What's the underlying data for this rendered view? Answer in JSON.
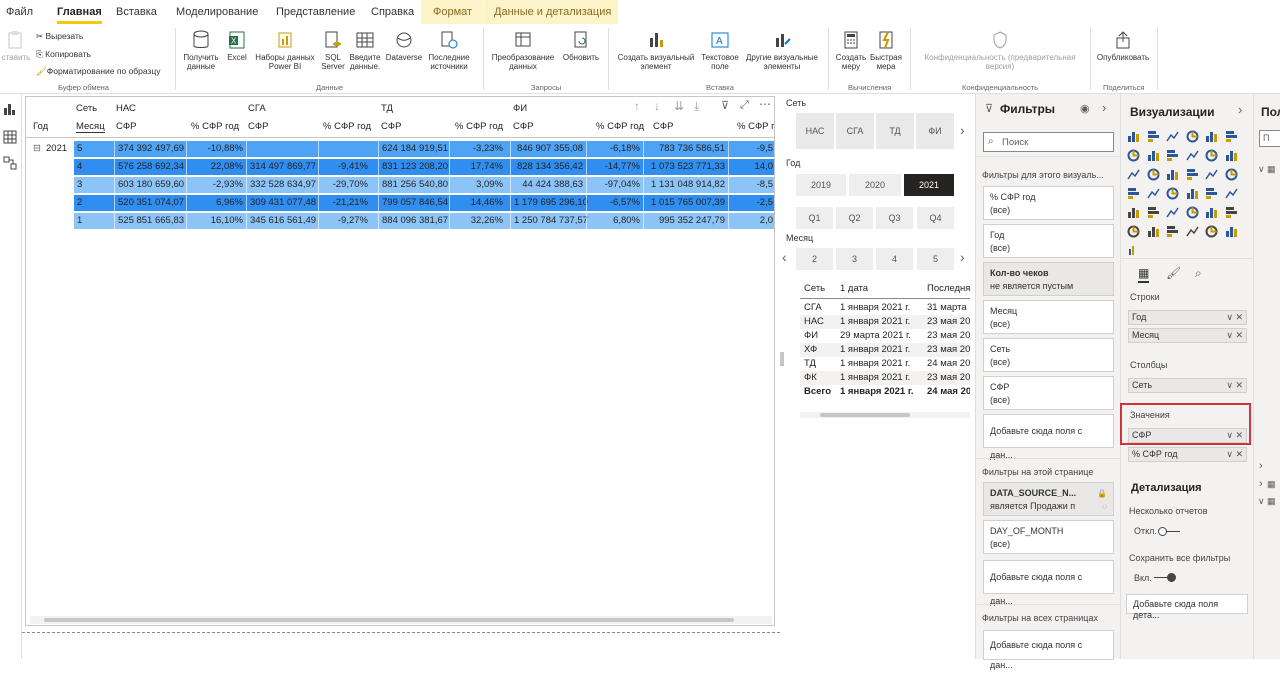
{
  "menu": {
    "items": [
      "Файл",
      "Главная",
      "Вставка",
      "Моделирование",
      "Представление",
      "Справка"
    ],
    "active": "Главная",
    "context_tabs": [
      "Формат",
      "Данные и детализация"
    ]
  },
  "ribbon": {
    "paste": "ставить",
    "cut": "Вырезать",
    "copy": "Копировать",
    "format_painter": "Форматирование по образцу",
    "clipboard_group": "Буфер обмена",
    "get_data": "Получить данные",
    "excel": "Excel",
    "datasets": "Наборы данных Power BI",
    "sql": "SQL Server",
    "enter_data": "Введите данные.",
    "dataverse": "Dataverse",
    "recent_sources": "Последние источники",
    "data_group": "Данные",
    "transform": "Преобразование данных",
    "refresh": "Обновить",
    "queries_group": "Запросы",
    "new_visual": "Создать визуальный элемент",
    "text_box": "Текстовое поле",
    "more_visuals": "Другие визуальные элементы",
    "insert_group": "Вставка",
    "new_measure": "Создать меру",
    "quick_measure": "Быстрая мера",
    "calc_group": "Вычисления",
    "sensitivity": "Конфиденциальность (предварительная версия)",
    "sensitivity_group": "Конфиденциальность",
    "publish": "Опубликовать",
    "share_group": "Поделиться"
  },
  "matrix": {
    "header_row1": {
      "set_label": "Сеть",
      "groups": [
        "НАС",
        "СГА",
        "ТД",
        "ФИ"
      ]
    },
    "header_row2": {
      "year": "Год",
      "month": "Месяц",
      "cols": [
        "СФР",
        "% СФР год",
        "СФР",
        "% СФР год",
        "СФР",
        "% СФР год",
        "СФР",
        "% СФР год",
        "СФР",
        "% СФР г"
      ]
    },
    "year_value": "2021",
    "expand_symbol": "⊟",
    "rows": [
      {
        "month": "5",
        "cells": [
          "374 392 497,69",
          "-10,88%",
          "",
          "",
          "624 184 919,51",
          "-3,23%",
          "846 907 355,08",
          "-6,18%",
          "783 736 586,51",
          "-9,5"
        ]
      },
      {
        "month": "4",
        "cells": [
          "576 258 692,34",
          "22,08%",
          "314 497 869,77",
          "-9,41%",
          "831 123 208,20",
          "17,74%",
          "828 134 356,42",
          "-14,77%",
          "1 073 523 771,33",
          "14,0"
        ]
      },
      {
        "month": "3",
        "cells": [
          "603 180 659,60",
          "-2,93%",
          "332 528 634,97",
          "-29,70%",
          "881 256 540,80",
          "3,09%",
          "44 424 388,63",
          "-97,04%",
          "1 131 048 914,82",
          "-8,5"
        ]
      },
      {
        "month": "2",
        "cells": [
          "520 351 074,07",
          "6,96%",
          "309 431 077,48",
          "-21,21%",
          "799 057 846,54",
          "14,46%",
          "1 179 695 296,10",
          "-6,57%",
          "1 015 765 007,39",
          "-2,5"
        ]
      },
      {
        "month": "1",
        "cells": [
          "525 851 665,83",
          "16,10%",
          "345 616 561,49",
          "-9,27%",
          "884 096 381,67",
          "32,26%",
          "1 250 784 737,57",
          "6,80%",
          "995 352 247,79",
          "2,0"
        ]
      }
    ],
    "row_colors": [
      "#4da3f5",
      "#2f8ef0",
      "#8cc4f7",
      "#2f8ef0",
      "#8cc4f7"
    ]
  },
  "slicers": {
    "set_title": "Сеть",
    "set_tiles": [
      "НАС",
      "СГА",
      "ТД",
      "ФИ"
    ],
    "year_title": "Год",
    "years": [
      "2019",
      "2020",
      "2021"
    ],
    "selected_year": "2021",
    "quarters": [
      "Q1",
      "Q2",
      "Q3",
      "Q4"
    ],
    "month_title": "Месяц",
    "months": [
      "2",
      "3",
      "4",
      "5"
    ]
  },
  "dates_table": {
    "headers": [
      "Сеть",
      "1 дата",
      "Последня"
    ],
    "rows": [
      [
        "СГА",
        "1 января 2021 г.",
        "31 марта"
      ],
      [
        "НАС",
        "1 января 2021 г.",
        "23 мая 20"
      ],
      [
        "ФИ",
        "29 марта 2021 г.",
        "23 мая 20"
      ],
      [
        "ХФ",
        "1 января 2021 г.",
        "23 мая 20"
      ],
      [
        "ТД",
        "1 января 2021 г.",
        "24 мая 20"
      ],
      [
        "ФК",
        "1 января 2021 г.",
        "23 мая 20"
      ]
    ],
    "total": [
      "Всего",
      "1 января 2021 г.",
      "24 мая 20"
    ]
  },
  "filters": {
    "title": "Фильтры",
    "search_placeholder": "Поиск",
    "visual_section": "Фильтры для этого визуаль...",
    "visual_cards": [
      {
        "name": "% СФР год",
        "value": "(все)"
      },
      {
        "name": "Год",
        "value": "(все)"
      },
      {
        "name": "Кол-во чеков",
        "value": "не является пустым"
      },
      {
        "name": "Месяц",
        "value": "(все)"
      },
      {
        "name": "Сеть",
        "value": "(все)"
      },
      {
        "name": "СФР",
        "value": "(все)"
      }
    ],
    "add_field": "Добавьте сюда поля с дан...",
    "page_section": "Фильтры на этой странице",
    "page_cards": [
      {
        "name": "DATA_SOURCE_N...",
        "value": "является Продажи п"
      },
      {
        "name": "DAY_OF_MONTH",
        "value": "(все)"
      }
    ],
    "all_pages_section": "Фильтры на всех страницах"
  },
  "viz": {
    "title": "Визуализации",
    "rows_label": "Строки",
    "rows": [
      "Год",
      "Месяц"
    ],
    "cols_label": "Столбцы",
    "cols": [
      "Сеть"
    ],
    "values_label": "Значения",
    "values": [
      "СФР",
      "% СФР год"
    ],
    "drill_title": "Детализация",
    "cross_report": "Несколько отчетов",
    "off": "Откл.",
    "keep_filters": "Сохранить все фильтры",
    "on": "Вкл.",
    "add_drill": "Добавьте сюда поля дета...",
    "highlight_color": "#d13438"
  },
  "fields_pane": {
    "title": "Пол",
    "search": "П"
  }
}
